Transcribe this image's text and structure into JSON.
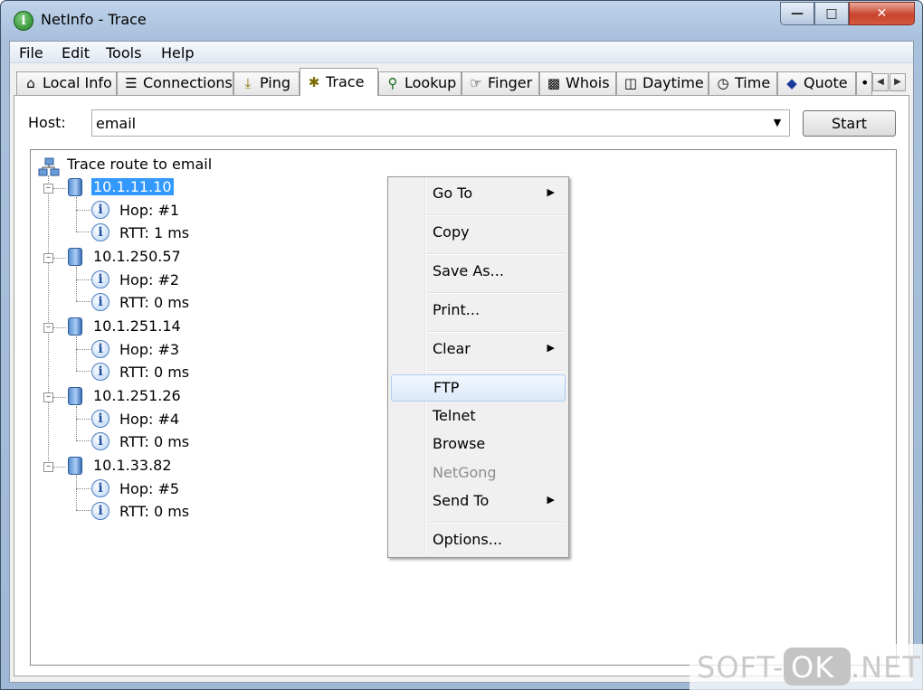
{
  "window": {
    "title": "NetInfo - Trace"
  },
  "menubar": [
    "File",
    "Edit",
    "Tools",
    "Help"
  ],
  "tabs": [
    {
      "label": "Local Info",
      "icon": "house-icon"
    },
    {
      "label": "Connections",
      "icon": "connections-icon"
    },
    {
      "label": "Ping",
      "icon": "ping-icon"
    },
    {
      "label": "Trace",
      "icon": "trace-icon"
    },
    {
      "label": "Lookup",
      "icon": "lookup-icon"
    },
    {
      "label": "Finger",
      "icon": "finger-icon"
    },
    {
      "label": "Whois",
      "icon": "whois-icon"
    },
    {
      "label": "Daytime",
      "icon": "daytime-icon"
    },
    {
      "label": "Time",
      "icon": "clock-icon"
    },
    {
      "label": "Quote",
      "icon": "quote-icon"
    }
  ],
  "host": {
    "label": "Host:",
    "value": "email"
  },
  "start_label": "Start",
  "tree": {
    "root": "Trace route to email",
    "hops": [
      {
        "ip": "10.1.11.10",
        "hop": "Hop: #1",
        "rtt": "RTT: 1 ms"
      },
      {
        "ip": "10.1.250.57",
        "hop": "Hop: #2",
        "rtt": "RTT: 0 ms"
      },
      {
        "ip": "10.1.251.14",
        "hop": "Hop: #3",
        "rtt": "RTT: 0 ms"
      },
      {
        "ip": "10.1.251.26",
        "hop": "Hop: #4",
        "rtt": "RTT: 0 ms"
      },
      {
        "ip": "10.1.33.82",
        "hop": "Hop: #5",
        "rtt": "RTT: 0 ms"
      }
    ]
  },
  "context_menu": {
    "goto": "Go To",
    "copy": "Copy",
    "save_as": "Save As...",
    "print": "Print...",
    "clear": "Clear",
    "ftp": "FTP",
    "telnet": "Telnet",
    "browse": "Browse",
    "netgong": "NetGong",
    "send_to": "Send To",
    "options": "Options..."
  },
  "watermark": {
    "left": "SOFT-",
    "middle": "OK",
    "right": ".NET"
  }
}
